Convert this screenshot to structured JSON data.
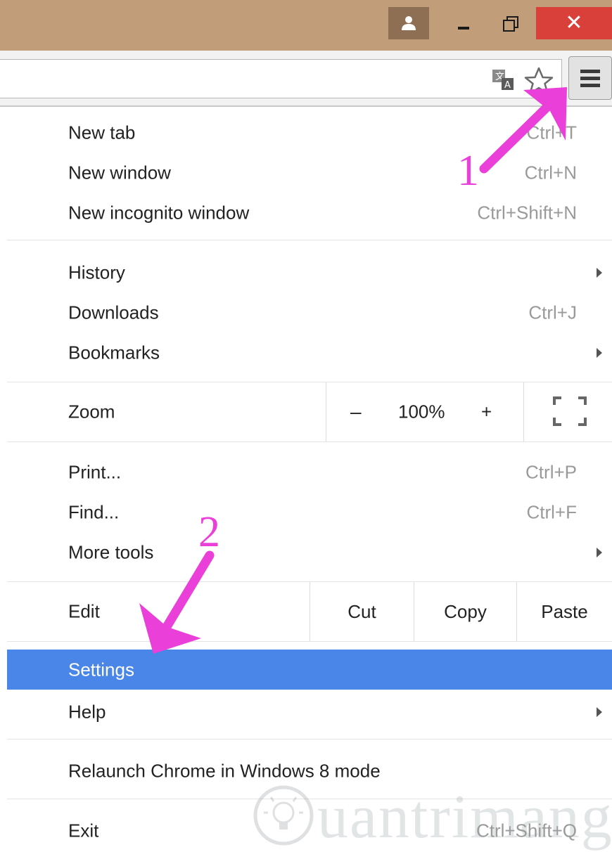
{
  "window": {
    "controls": {
      "user_icon": "user-icon",
      "minimize_icon": "minimize-icon",
      "maximize_icon": "restore-icon",
      "close_label": "✕"
    },
    "titlebar_color": "#c19d7a",
    "close_color": "#d9403a"
  },
  "toolbar": {
    "icons": [
      "translate-icon",
      "bookmark-star-icon",
      "hamburger-menu-icon"
    ]
  },
  "menu": {
    "highlight_color": "#4a86e8",
    "items": {
      "new_tab": {
        "label": "New tab",
        "shortcut": "Ctrl+T"
      },
      "new_window": {
        "label": "New window",
        "shortcut": "Ctrl+N"
      },
      "new_incognito": {
        "label": "New incognito window",
        "shortcut": "Ctrl+Shift+N"
      },
      "history": {
        "label": "History"
      },
      "downloads": {
        "label": "Downloads",
        "shortcut": "Ctrl+J"
      },
      "bookmarks": {
        "label": "Bookmarks"
      },
      "print": {
        "label": "Print...",
        "shortcut": "Ctrl+P"
      },
      "find": {
        "label": "Find...",
        "shortcut": "Ctrl+F"
      },
      "more_tools": {
        "label": "More tools"
      },
      "settings": {
        "label": "Settings"
      },
      "help": {
        "label": "Help"
      },
      "relaunch": {
        "label": "Relaunch Chrome in Windows 8 mode"
      },
      "exit": {
        "label": "Exit",
        "shortcut": "Ctrl+Shift+Q"
      }
    },
    "zoom": {
      "label": "Zoom",
      "minus": "–",
      "level": "100%",
      "plus": "+"
    },
    "edit": {
      "label": "Edit",
      "cut": "Cut",
      "copy": "Copy",
      "paste": "Paste"
    }
  },
  "annotations": {
    "step_1": "1",
    "step_2": "2",
    "arrow_color": "#ea3fd8"
  },
  "watermark": {
    "text": "uantrimang"
  }
}
